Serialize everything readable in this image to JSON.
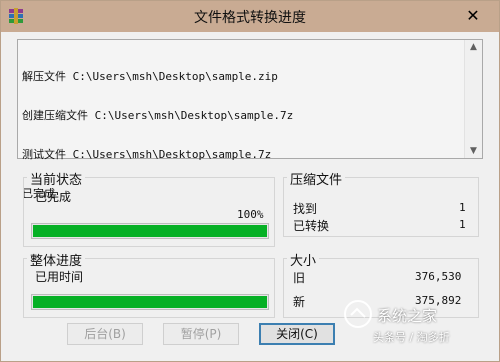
{
  "window": {
    "title": "文件格式转换进度",
    "close_glyph": "✕"
  },
  "log": {
    "lines": [
      "解压文件 C:\\Users\\msh\\Desktop\\sample.zip",
      "创建压缩文件 C:\\Users\\msh\\Desktop\\sample.7z",
      "测试文件 C:\\Users\\msh\\Desktop\\sample.7z",
      "已完成"
    ],
    "scroll_up": "▲",
    "scroll_down": "▼"
  },
  "current_status": {
    "label": "当前状态",
    "status_text": "已完成",
    "percent_text": "100%",
    "progress": 1.0
  },
  "overall": {
    "label": "整体进度",
    "elapsed_label": "已用时间",
    "progress": 1.0
  },
  "compressed_files": {
    "label": "压缩文件",
    "found_label": "找到",
    "found_value": "1",
    "converted_label": "已转换",
    "converted_value": "1"
  },
  "size": {
    "label": "大小",
    "old_label": "旧",
    "old_value": "376,530",
    "new_label": "新",
    "new_value": "375,892"
  },
  "buttons": {
    "background": "后台(B)",
    "pause": "暂停(P)",
    "close": "关闭(C)"
  },
  "watermark": {
    "text": "系统之家",
    "subtext": "头条号 / 淘多折"
  },
  "colors": {
    "titlebar": "#c9ab93",
    "progress_fill": "#06b025"
  }
}
